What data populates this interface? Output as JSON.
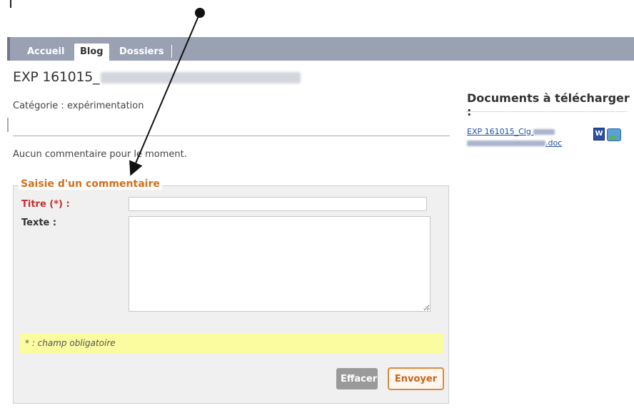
{
  "nav": {
    "tabs": [
      {
        "label": "Accueil"
      },
      {
        "label": "Blog"
      },
      {
        "label": "Dossiers"
      }
    ]
  },
  "post": {
    "title": "EXP 161015_",
    "category": "Catégorie : expérimentation",
    "no_comments": "Aucun commentaire pour le moment."
  },
  "documents": {
    "heading": "Documents à télécharger :",
    "link_start": "EXP 161015_Clg",
    "link_end": ".doc",
    "word_icon_text": "W"
  },
  "form": {
    "legend": "Saisie d'un commentaire",
    "title_label": "Titre (*) :",
    "text_label": "Texte :",
    "title_value": "",
    "text_value": "",
    "required_note": "* : champ obligatoire",
    "clear_button": "Effacer",
    "send_button": "Envoyer"
  },
  "colors": {
    "nav_bar": "#9aa1b3",
    "legend": "#d0701d",
    "required": "#c62f2f",
    "note_bg": "#fbfb9f"
  }
}
